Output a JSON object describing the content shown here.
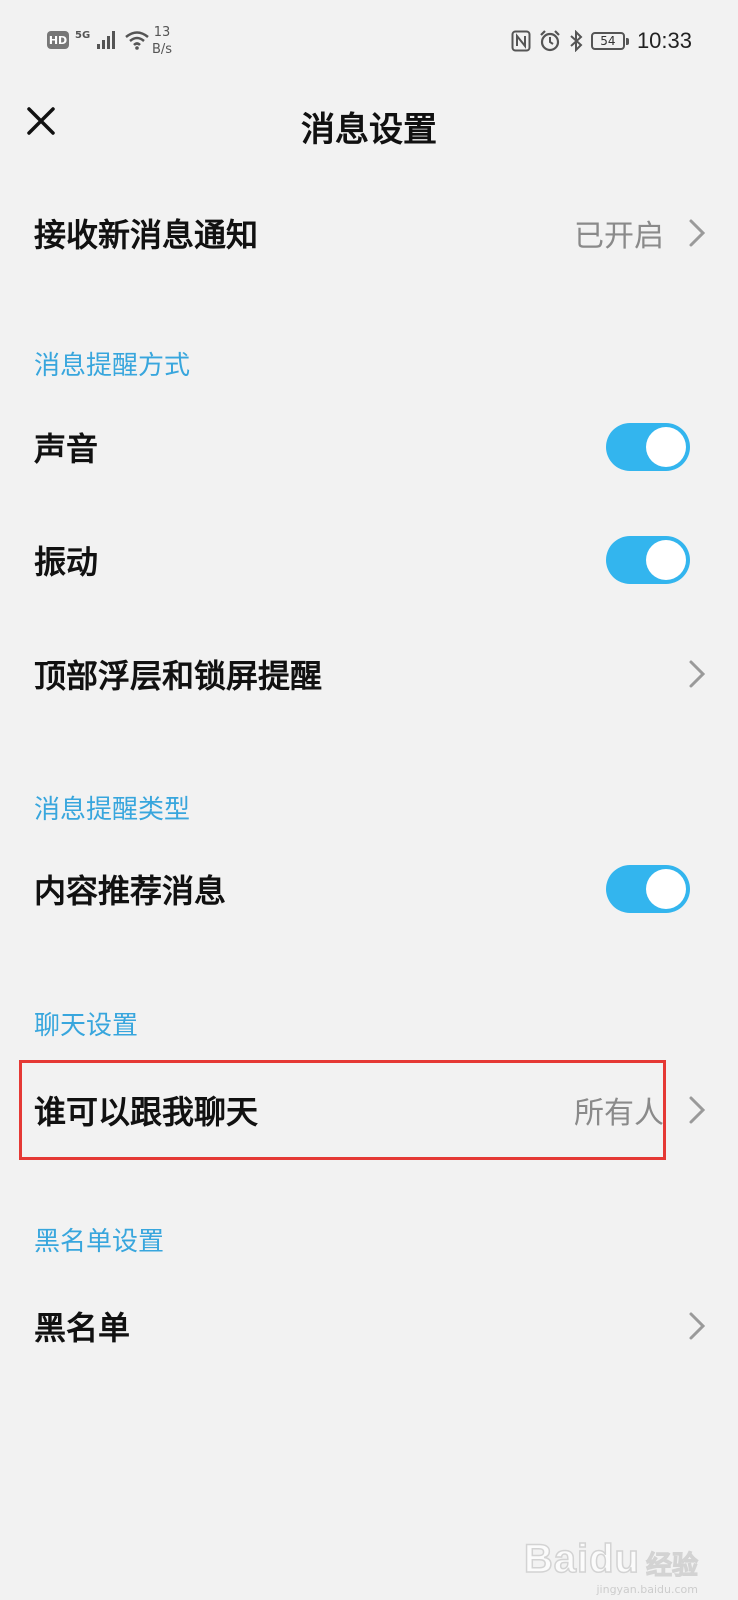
{
  "status_bar": {
    "hd_badge": "HD",
    "network": "5G",
    "speed_value": "13",
    "speed_unit": "B/s",
    "battery_level": "54",
    "time": "10:33",
    "icons": [
      "hd-icon",
      "signal-icon",
      "wifi-icon",
      "nfc-icon",
      "alarm-icon",
      "bluetooth-icon",
      "battery-icon"
    ]
  },
  "header": {
    "title": "消息设置",
    "close_icon": "close-icon"
  },
  "settings": {
    "receive_notifications": {
      "label": "接收新消息通知",
      "value": "已开启"
    },
    "section_reminder_method": "消息提醒方式",
    "sound": {
      "label": "声音",
      "enabled": true
    },
    "vibration": {
      "label": "振动",
      "enabled": true
    },
    "floating_lockscreen": {
      "label": "顶部浮层和锁屏提醒"
    },
    "section_reminder_type": "消息提醒类型",
    "content_recommendations": {
      "label": "内容推荐消息",
      "enabled": true
    },
    "section_chat": "聊天设置",
    "who_can_chat": {
      "label": "谁可以跟我聊天",
      "value": "所有人"
    },
    "section_blacklist": "黑名单设置",
    "blacklist": {
      "label": "黑名单"
    }
  },
  "colors": {
    "accent": "#38a6dd",
    "toggle_on": "#33b5ee",
    "highlight": "#e53935",
    "background": "#f2f2f2"
  },
  "watermark": {
    "logo": "Baidu",
    "text": "经验",
    "sub": "jingyan.baidu.com"
  }
}
